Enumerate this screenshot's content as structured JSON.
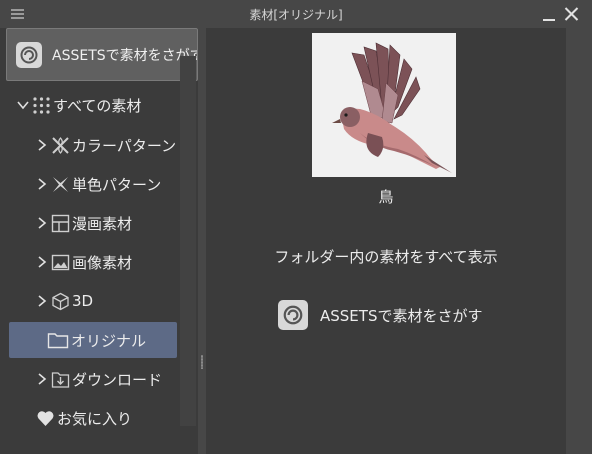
{
  "window": {
    "title": "素材[オリジナル]"
  },
  "sidebar": {
    "assets_button_label": "ASSETSで素材をさがす",
    "items": [
      {
        "label": "すべての素材",
        "icon": "grid-dots-icon"
      },
      {
        "label": "カラーパターン",
        "icon": "color-pattern-icon"
      },
      {
        "label": "単色パターン",
        "icon": "mono-pattern-icon"
      },
      {
        "label": "漫画素材",
        "icon": "manga-panel-icon"
      },
      {
        "label": "画像素材",
        "icon": "image-icon"
      },
      {
        "label": "3D",
        "icon": "cube-icon"
      },
      {
        "label": "オリジナル",
        "icon": "folder-icon"
      },
      {
        "label": "ダウンロード",
        "icon": "download-icon"
      },
      {
        "label": "お気に入り",
        "icon": "heart-icon"
      }
    ]
  },
  "main": {
    "thumbnail_label": "鳥",
    "show_all_label": "フォルダー内の素材をすべて表示",
    "assets_link_label": "ASSETSで素材をさがす"
  },
  "colors": {
    "selected_bg": "#5d6a86",
    "panel_bg": "#3b3b3b",
    "frame_bg": "#474747"
  }
}
